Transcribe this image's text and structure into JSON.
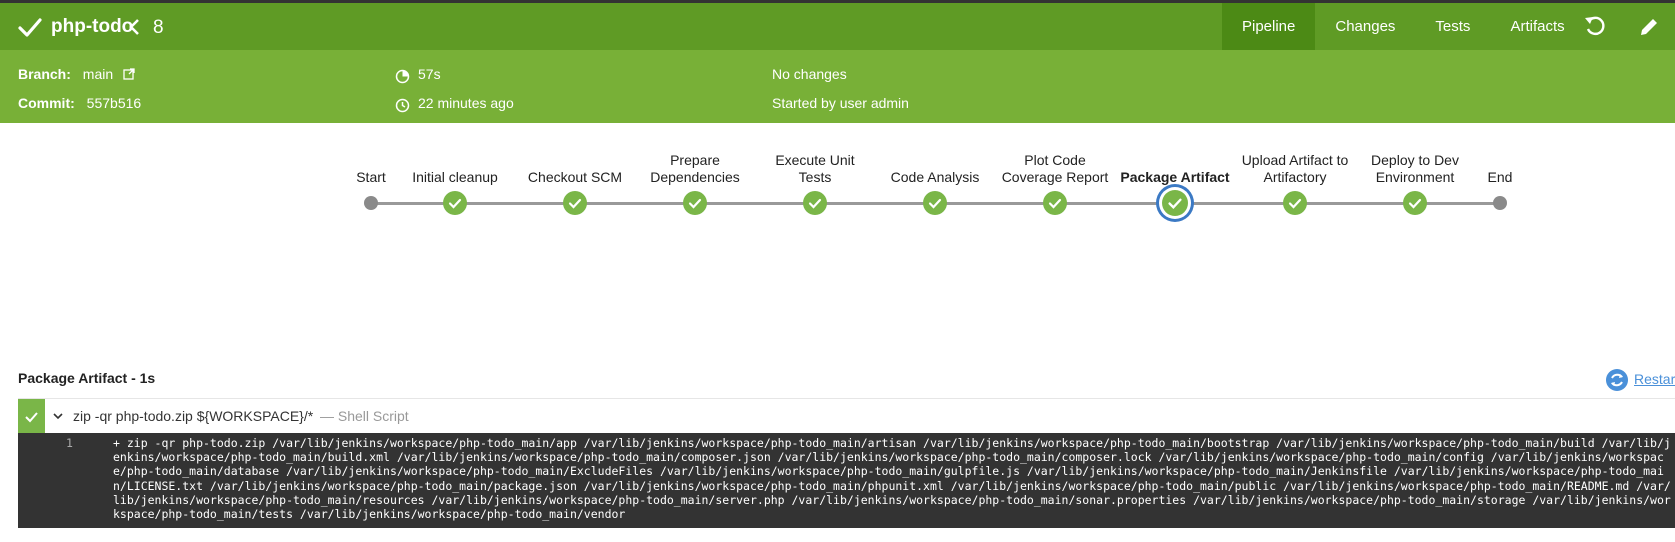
{
  "header": {
    "job_name": "php-todo",
    "run_number": "8",
    "tabs": [
      "Pipeline",
      "Changes",
      "Tests",
      "Artifacts"
    ],
    "branch_label": "Branch:",
    "branch_value": "main",
    "commit_label": "Commit:",
    "commit_value": "557b516",
    "duration": "57s",
    "time_ago": "22 minutes ago",
    "changes": "No changes",
    "started_by": "Started by user admin"
  },
  "pipeline": {
    "stages": [
      {
        "label": "Start",
        "status": "start"
      },
      {
        "label": "Initial cleanup",
        "status": "success"
      },
      {
        "label": "Checkout SCM",
        "status": "success"
      },
      {
        "label": "Prepare\nDependencies",
        "status": "success"
      },
      {
        "label": "Execute Unit\nTests",
        "status": "success"
      },
      {
        "label": "Code Analysis",
        "status": "success"
      },
      {
        "label": "Plot Code\nCoverage Report",
        "status": "success"
      },
      {
        "label": "Package Artifact",
        "status": "success",
        "selected": true
      },
      {
        "label": "Upload Artifact to\nArtifactory",
        "status": "success"
      },
      {
        "label": "Deploy to Dev\nEnvironment",
        "status": "success"
      },
      {
        "label": "End",
        "status": "end"
      }
    ]
  },
  "step_panel": {
    "title": "Package Artifact - 1s",
    "restart_label": "Restart",
    "step_command": "zip -qr php-todo.zip ${WORKSPACE}/*",
    "step_type": "— Shell Script",
    "log_line_number": "1",
    "log_text": "+ zip -qr php-todo.zip /var/lib/jenkins/workspace/php-todo_main/app /var/lib/jenkins/workspace/php-todo_main/artisan /var/lib/jenkins/workspace/php-todo_main/bootstrap /var/lib/jenkins/workspace/php-todo_main/build /var/lib/jenkins/workspace/php-todo_main/build.xml /var/lib/jenkins/workspace/php-todo_main/composer.json /var/lib/jenkins/workspace/php-todo_main/composer.lock /var/lib/jenkins/workspace/php-todo_main/config /var/lib/jenkins/workspace/php-todo_main/database /var/lib/jenkins/workspace/php-todo_main/ExcludeFiles /var/lib/jenkins/workspace/php-todo_main/gulpfile.js /var/lib/jenkins/workspace/php-todo_main/Jenkinsfile /var/lib/jenkins/workspace/php-todo_main/LICENSE.txt /var/lib/jenkins/workspace/php-todo_main/package.json /var/lib/jenkins/workspace/php-todo_main/phpunit.xml /var/lib/jenkins/workspace/php-todo_main/public /var/lib/jenkins/workspace/php-todo_main/README.md /var/lib/jenkins/workspace/php-todo_main/resources /var/lib/jenkins/workspace/php-todo_main/server.php /var/lib/jenkins/workspace/php-todo_main/sonar.properties /var/lib/jenkins/workspace/php-todo_main/storage /var/lib/jenkins/workspace/php-todo_main/tests /var/lib/jenkins/workspace/php-todo_main/vendor"
  },
  "colors": {
    "header_green": "#78b037",
    "titlebar_green": "#5f9b25",
    "success_green": "#7ab648",
    "selected_ring": "#3b79c4",
    "console_bg": "#333333"
  },
  "icons": [
    "check-icon",
    "chevron-left-icon",
    "external-link-icon",
    "duration-icon",
    "clock-icon",
    "replay-icon",
    "edit-icon",
    "restart-icon",
    "caret-down-icon"
  ]
}
